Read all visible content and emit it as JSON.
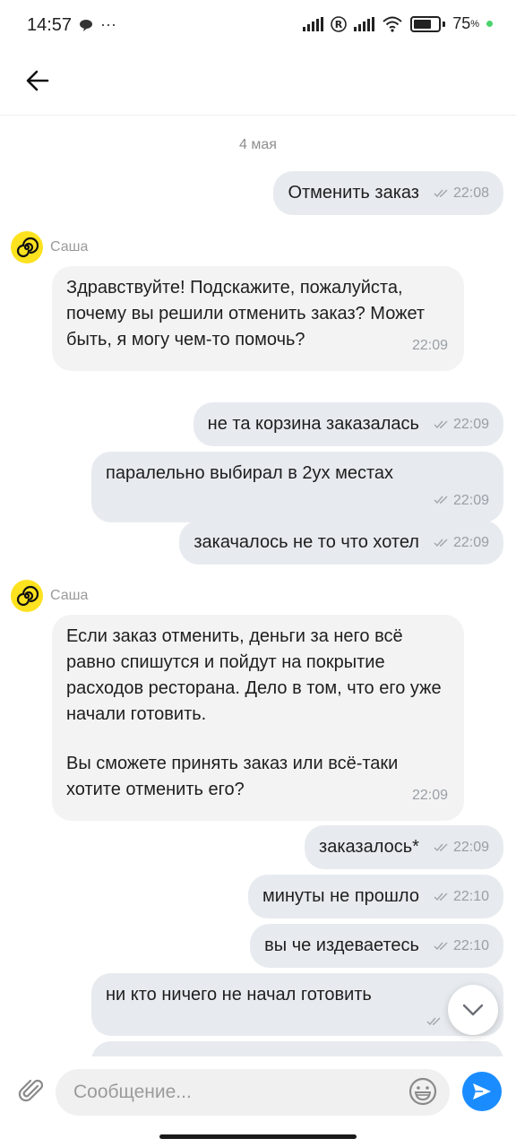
{
  "status_bar": {
    "time": "14:57",
    "more": "···",
    "battery": "75"
  },
  "chat": {
    "date": "4 мая",
    "messages": [
      {
        "text": "Отменить заказ",
        "time": "22:08"
      },
      {
        "sender": "Саша",
        "text": "Здравствуйте! Подскажите, пожалуйста, почему вы решили отменить заказ? Может быть, я могу чем-то помочь?",
        "time": "22:09"
      },
      {
        "text": "не та корзина заказалась",
        "time": "22:09"
      },
      {
        "text": "паралельно выбирал в 2ух местах",
        "time": "22:09"
      },
      {
        "text": "закачалось не то что хотел",
        "time": "22:09"
      },
      {
        "sender": "Саша",
        "text_p1": "Если заказ отменить, деньги за него всё равно спишутся и пойдут на покрытие расходов ресторана. Дело в том, что его уже начали готовить.",
        "text_p2": "Вы сможете принять заказ или всё-таки хотите отменить его?",
        "time": "22:09"
      },
      {
        "text": "заказалось*",
        "time": "22:09"
      },
      {
        "text": "минуты не прошло",
        "time": "22:10"
      },
      {
        "text": "вы че издеваетесь",
        "time": "22:10"
      },
      {
        "text": "ни кто ничего не начал готовить"
      }
    ]
  },
  "input": {
    "placeholder": "Сообщение..."
  },
  "colors": {
    "outgoing_bubble": "#e7ebef",
    "incoming_bubble": "#f3f3f3",
    "avatar": "#fde21f",
    "send_button": "#1a8cff"
  },
  "icons": [
    "back-arrow-icon",
    "attach-icon",
    "emoji-icon",
    "send-icon",
    "chevron-down-icon",
    "double-check-icon"
  ]
}
